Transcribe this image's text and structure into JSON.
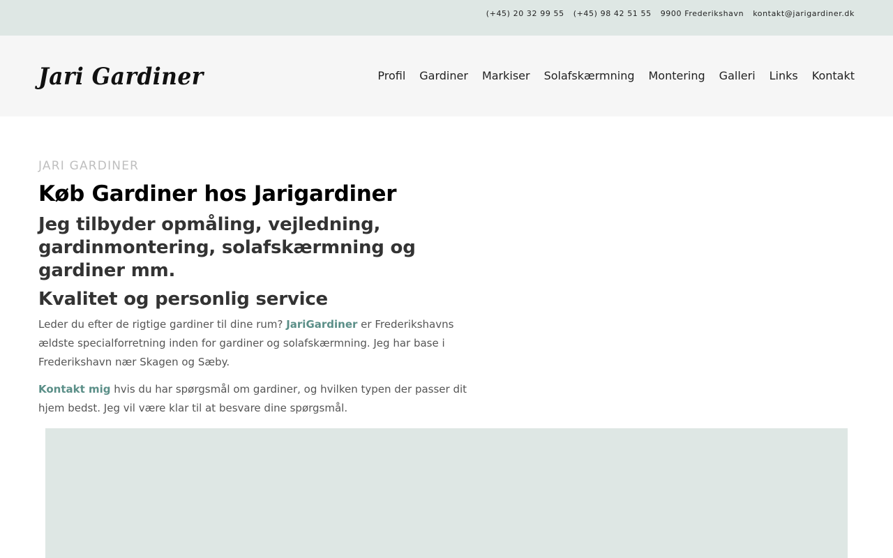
{
  "topbar": {
    "phone1": "(+45) 20 32 99 55",
    "phone2": "(+45) 98 42 51 55",
    "city": "9900 Frederikshavn",
    "email": "kontakt@jarigardiner.dk"
  },
  "header": {
    "logo_text": "Jari Gardiner",
    "nav": [
      "Profil",
      "Gardiner",
      "Markiser",
      "Solafskærmning",
      "Montering",
      "Galleri",
      "Links",
      "Kontakt"
    ]
  },
  "main": {
    "eyebrow": "JARI GARDINER",
    "title": "Køb Gardiner hos Jarigardiner",
    "subtitle": "Jeg tilbyder opmåling, vejledning, gardinmontering, solafskærmning og gardiner mm.",
    "quality_heading": "Kvalitet og personlig service",
    "para1_before": "Leder du efter de rigtige gardiner til dine rum? ",
    "para1_link": "JariGardiner",
    "para1_after": " er Frederikshavns ældste specialforretning inden for gardiner og solafskærmning. Jeg har base i Frederikshavn nær Skagen og Sæby.",
    "para2_link": "Kontakt mig",
    "para2_after": " hvis du har spørgsmål om gardiner, og hvilken typen der passer dit hjem bedst. Jeg vil være klar til at besvare dine spørgsmål."
  },
  "colors": {
    "topbar_bg": "#dee7e4",
    "header_bg": "#f6f6f6",
    "link": "#5b8f88",
    "banner_bg": "#dee7e4"
  }
}
